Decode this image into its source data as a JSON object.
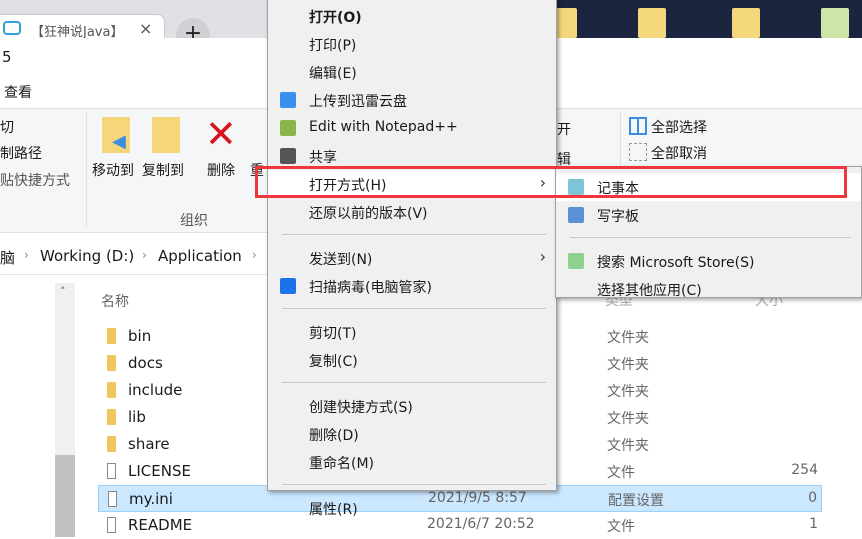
{
  "browser": {
    "tab_title": "【狂神说Java】",
    "close": "×",
    "new_tab": "+"
  },
  "window": {
    "title": "5",
    "menu_view": "查看"
  },
  "ribbon": {
    "clipboard": [
      "切",
      "制路径",
      "贴快捷方式"
    ],
    "move_to": "移动到",
    "copy_to": "复制到",
    "delete": "删除",
    "rename": "重",
    "group_organize": "组织",
    "open": "开",
    "edit": "辑",
    "select_all": "全部选择",
    "select_none": "全部取消"
  },
  "address": {
    "crumbs": [
      "脑",
      "Working (D:)",
      "Application"
    ]
  },
  "columns": {
    "name": "名称",
    "type": "类型",
    "size": "大小"
  },
  "files": [
    {
      "name": "bin",
      "date": "",
      "type": "文件夹",
      "size": "",
      "kind": "folder"
    },
    {
      "name": "docs",
      "date": "",
      "type": "文件夹",
      "size": "",
      "kind": "folder"
    },
    {
      "name": "include",
      "date": "",
      "type": "文件夹",
      "size": "",
      "kind": "folder"
    },
    {
      "name": "lib",
      "date": "",
      "type": "文件夹",
      "size": "",
      "kind": "folder"
    },
    {
      "name": "share",
      "date": "",
      "type": "文件夹",
      "size": "",
      "kind": "folder"
    },
    {
      "name": "LICENSE",
      "date": "",
      "type": "文件",
      "size": "254",
      "kind": "file"
    },
    {
      "name": "my.ini",
      "date": "2021/9/5 8:57",
      "type": "配置设置",
      "size": "0",
      "kind": "ini",
      "selected": true
    },
    {
      "name": "README",
      "date": "2021/6/7 20:52",
      "type": "文件",
      "size": "1",
      "kind": "file"
    }
  ],
  "context_menu": [
    {
      "label": "打开(O)",
      "bold": true
    },
    {
      "label": "打印(P)"
    },
    {
      "label": "编辑(E)"
    },
    {
      "label": "上传到迅雷云盘",
      "icon": "thunder-bird-icon",
      "color": "#3b8ff0"
    },
    {
      "label": "Edit with Notepad++",
      "icon": "notepad-plus-plus-icon",
      "color": "#8ab54a"
    },
    {
      "label": "共享",
      "icon": "share-icon",
      "color": "#555555"
    },
    {
      "label": "打开方式(H)",
      "submenu": true,
      "highlight": true
    },
    {
      "label": "还原以前的版本(V)"
    },
    {
      "sep": true
    },
    {
      "label": "发送到(N)",
      "submenu": true
    },
    {
      "label": "扫描病毒(电脑管家)",
      "icon": "shield-icon",
      "color": "#1a73e8"
    },
    {
      "sep": true
    },
    {
      "label": "剪切(T)"
    },
    {
      "label": "复制(C)"
    },
    {
      "sep": true
    },
    {
      "label": "创建快捷方式(S)"
    },
    {
      "label": "删除(D)"
    },
    {
      "label": "重命名(M)"
    },
    {
      "sep": true
    },
    {
      "label": "属性(R)"
    }
  ],
  "open_with_menu": [
    {
      "label": "记事本",
      "icon": "notepad-icon",
      "color": "#7fc3d8",
      "highlight": true
    },
    {
      "label": "写字板",
      "icon": "wordpad-icon",
      "color": "#5b8fd6"
    },
    {
      "sep": true
    },
    {
      "label": "搜索 Microsoft Store(S)",
      "icon": "store-icon",
      "color": "#8fd18f"
    },
    {
      "label": "选择其他应用(C)"
    }
  ],
  "highlight_color": "#f0363d"
}
